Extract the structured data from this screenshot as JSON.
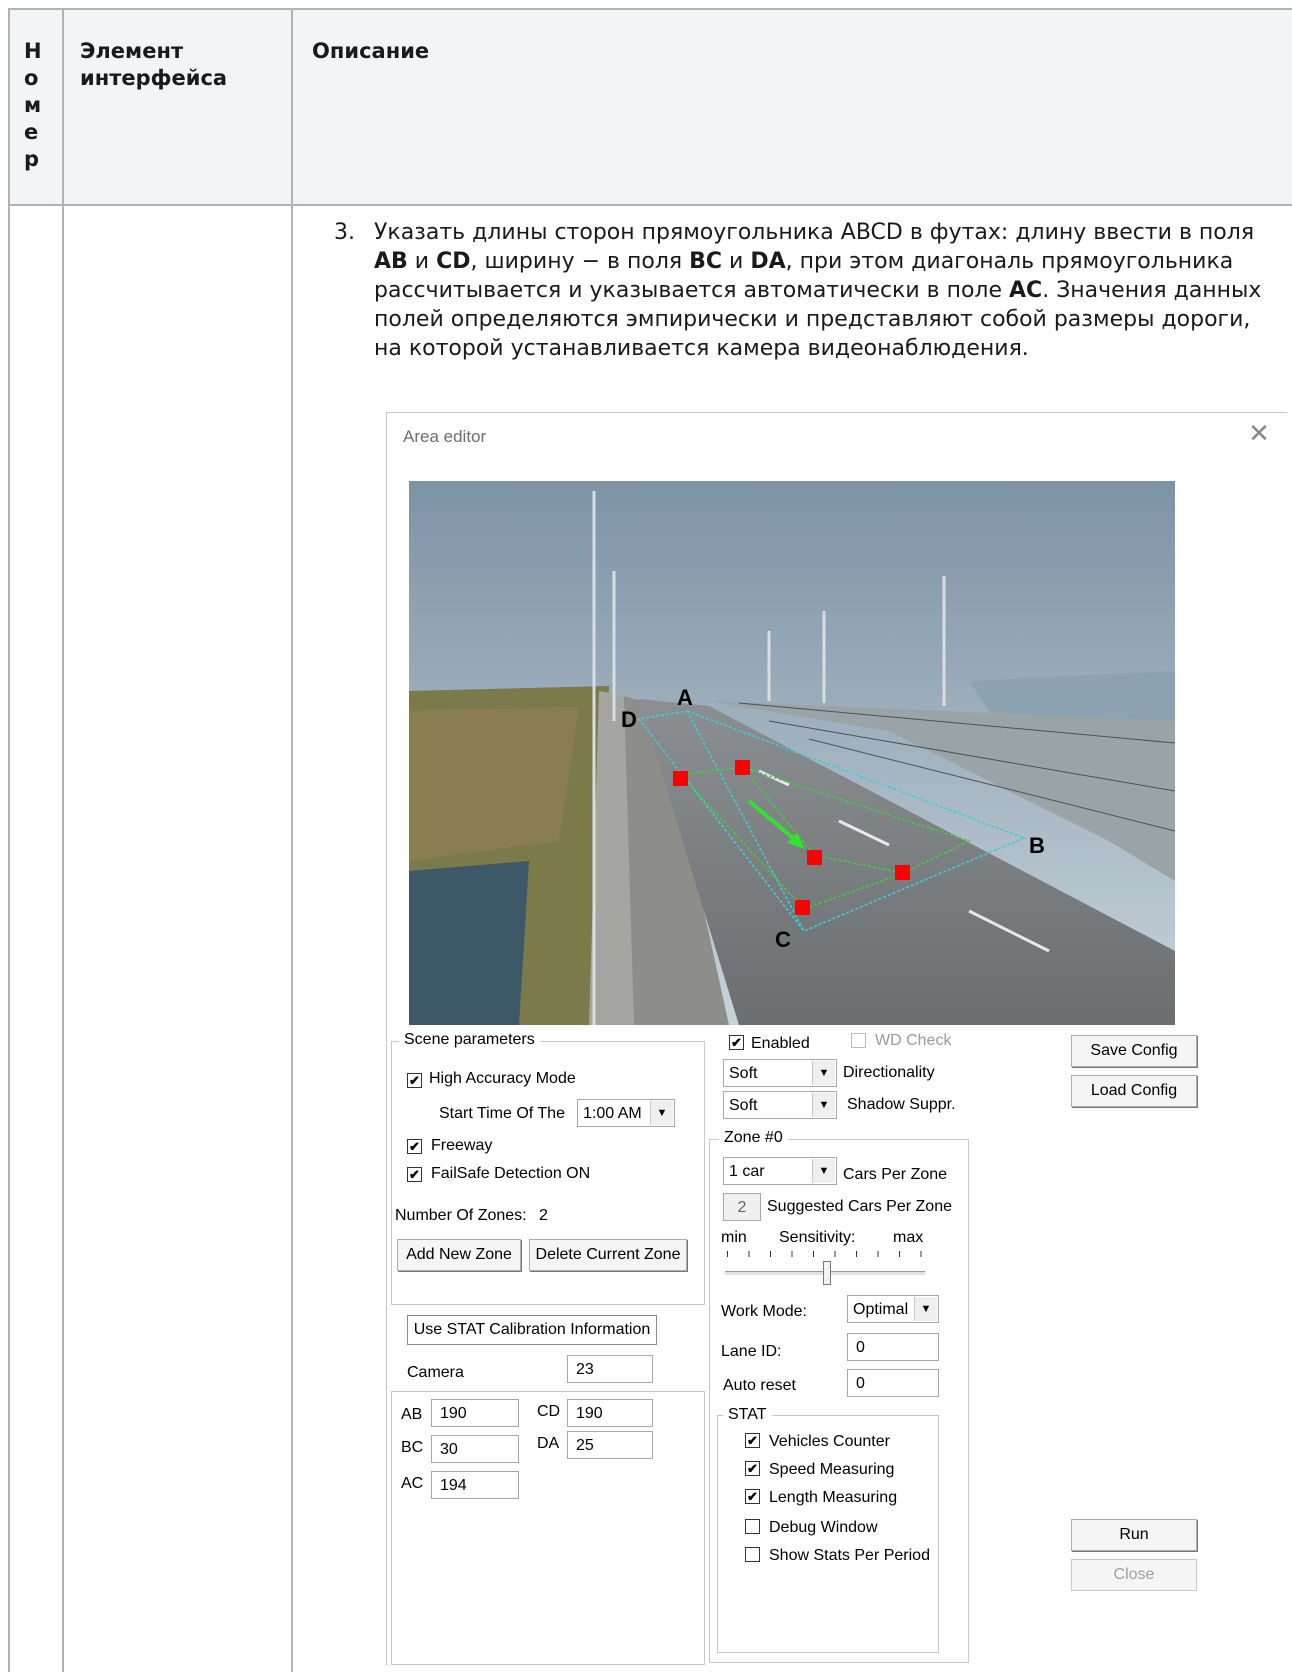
{
  "table": {
    "headers": [
      "Н\nо\nм\nе\nр",
      "Элемент\nинтерфейса",
      "Описание"
    ]
  },
  "description": {
    "number": "3.",
    "parts": [
      "Указать длины сторон прямоугольника ABCD в футах: длину ввести в поля ",
      "AB",
      " и ",
      "CD",
      ", ширину − в поля ",
      "BC",
      " и ",
      "DA",
      ", при этом диагональ прямоугольника рассчитывается и указывается автоматически в поле ",
      "AC",
      ". Значения данных полей определяются эмпирически и представляют собой размеры дороги, на которой устанавливается камера видеонаблюдения."
    ]
  },
  "dialog": {
    "title": "Area editor",
    "close_icon": "close-icon",
    "points": {
      "a": "A",
      "b": "B",
      "c": "C",
      "d": "D"
    },
    "scene": {
      "legend": "Scene parameters",
      "high_accuracy": {
        "label": "High Accuracy Mode",
        "checked": true
      },
      "start_time_label": "Start Time Of The",
      "start_time_value": "1:00 AM",
      "freeway": {
        "label": "Freeway",
        "checked": true
      },
      "failsafe": {
        "label": "FailSafe Detection ON",
        "checked": true
      },
      "zones_label": "Number Of Zones:",
      "zones_value": "2",
      "add_zone": "Add New Zone",
      "delete_zone": "Delete Current Zone"
    },
    "calibration": {
      "use_stat": "Use STAT Calibration Information",
      "camera_label": "Camera",
      "camera_value": "23",
      "ab_label": "AB",
      "ab_value": "190",
      "cd_label": "CD",
      "cd_value": "190",
      "bc_label": "BC",
      "bc_value": "30",
      "da_label": "DA",
      "da_value": "25",
      "ac_label": "AC",
      "ac_value": "194"
    },
    "middle": {
      "enabled": {
        "label": "Enabled",
        "checked": true
      },
      "wd_check": {
        "label": "WD Check",
        "checked": false
      },
      "directionality_value": "Soft",
      "directionality_label": "Directionality",
      "shadow_value": "Soft",
      "shadow_label": "Shadow Suppr.",
      "zone_legend": "Zone #0",
      "cars_value": "1 car",
      "cars_label": "Cars Per Zone",
      "suggested_value": "2",
      "suggested_label": "Suggested Cars Per Zone",
      "sens_min": "min",
      "sens_label": "Sensitivity:",
      "sens_max": "max",
      "work_mode_label": "Work Mode:",
      "work_mode_value": "Optimal",
      "lane_id_label": "Lane ID:",
      "lane_id_value": "0",
      "auto_reset_label": "Auto reset",
      "auto_reset_value": "0",
      "stat_legend": "STAT",
      "vehicles_counter": {
        "label": "Vehicles Counter",
        "checked": true
      },
      "speed_measuring": {
        "label": "Speed Measuring",
        "checked": true
      },
      "length_measuring": {
        "label": "Length Measuring",
        "checked": true
      },
      "debug_window": {
        "label": "Debug Window",
        "checked": false
      },
      "show_stats": {
        "label": "Show Stats Per Period",
        "checked": false
      }
    },
    "right": {
      "save_config": "Save Config",
      "load_config": "Load Config",
      "run": "Run",
      "close": "Close"
    },
    "check_mark": "✔",
    "dropdown_arrow": "▼"
  }
}
